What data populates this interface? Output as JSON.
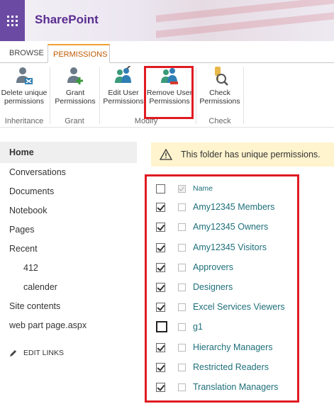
{
  "suitebar": {
    "app_name": "SharePoint",
    "accent": "#6b4aa3"
  },
  "ribbon": {
    "tabs": [
      {
        "label": "BROWSE"
      },
      {
        "label": "PERMISSIONS",
        "active": true
      }
    ],
    "buttons": {
      "delete_unique": {
        "line1": "Delete unique",
        "line2": "permissions"
      },
      "grant": {
        "line1": "Grant",
        "line2": "Permissions"
      },
      "edit_user": {
        "line1": "Edit User",
        "line2": "Permissions"
      },
      "remove_user": {
        "line1": "Remove User",
        "line2": "Permissions"
      },
      "check": {
        "line1": "Check",
        "line2": "Permissions"
      }
    },
    "groups": {
      "inheritance": "Inheritance",
      "grant": "Grant",
      "modify": "Modify",
      "check": "Check"
    }
  },
  "leftnav": {
    "home": "Home",
    "items": [
      "Conversations",
      "Documents",
      "Notebook",
      "Pages",
      "Recent"
    ],
    "recent_items": [
      "412",
      "calender"
    ],
    "bottom_items": [
      "Site contents",
      "web part page.aspx"
    ],
    "edit_links": "EDIT LINKS"
  },
  "banner": {
    "text": "This folder has unique permissions."
  },
  "permissions": {
    "header": "Name",
    "rows": [
      {
        "name": "Amy12345 Members",
        "checked": true
      },
      {
        "name": "Amy12345 Owners",
        "checked": true
      },
      {
        "name": "Amy12345 Visitors",
        "checked": true
      },
      {
        "name": "Approvers",
        "checked": true
      },
      {
        "name": "Designers",
        "checked": true
      },
      {
        "name": "Excel Services Viewers",
        "checked": true
      },
      {
        "name": "g1",
        "checked": false
      },
      {
        "name": "Hierarchy Managers",
        "checked": true
      },
      {
        "name": "Restricted Readers",
        "checked": true
      },
      {
        "name": "Translation Managers",
        "checked": true
      }
    ]
  },
  "colors": {
    "highlight_box": "#e01b22",
    "link": "#1e6f7a",
    "brand_text": "#5a2d91"
  }
}
